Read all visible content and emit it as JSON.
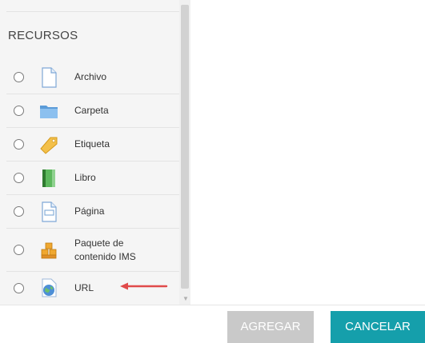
{
  "section": {
    "title": "RECURSOS"
  },
  "items": [
    {
      "label": "Archivo",
      "icon": "file-icon"
    },
    {
      "label": "Carpeta",
      "icon": "folder-icon"
    },
    {
      "label": "Etiqueta",
      "icon": "tag-icon"
    },
    {
      "label": "Libro",
      "icon": "book-icon"
    },
    {
      "label": "Página",
      "icon": "page-icon"
    },
    {
      "label": "Paquete de contenido IMS",
      "icon": "ims-package-icon"
    },
    {
      "label": "URL",
      "icon": "url-globe-icon"
    }
  ],
  "buttons": {
    "add": "AGREGAR",
    "cancel": "CANCELAR"
  },
  "colors": {
    "cancel": "#159fab",
    "add_disabled": "#c9c9c9",
    "arrow": "#e04a4a"
  }
}
